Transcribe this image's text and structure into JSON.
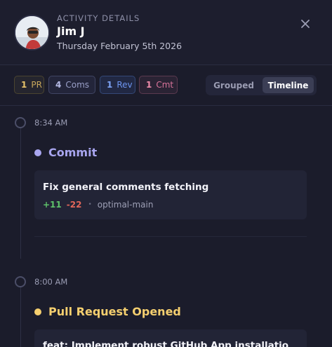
{
  "header": {
    "eyebrow": "ACTIVITY DETAILS",
    "name": "Jim J",
    "date": "Thursday February 5th 2026"
  },
  "filters": [
    {
      "count": "1",
      "label": "PR"
    },
    {
      "count": "4",
      "label": "Coms"
    },
    {
      "count": "1",
      "label": "Rev"
    },
    {
      "count": "1",
      "label": "Cmt"
    }
  ],
  "view_toggle": {
    "grouped": "Grouped",
    "timeline": "Timeline",
    "selected": "Timeline"
  },
  "events": [
    {
      "time": "8:34 AM",
      "type": "Commit",
      "title": "Fix general comments fetching",
      "additions": "+11",
      "deletions": "-22",
      "separator": "•",
      "branch": "optimal-main"
    },
    {
      "time": "8:00 AM",
      "type": "Pull Request Opened",
      "title": "feat: Implement robust GitHub App installatio"
    }
  ],
  "colors": {
    "background": "#1b1c2b",
    "pr": "#e7c36a",
    "coms": "#9aa0d6",
    "rev": "#6d95f0",
    "cmt": "#e67a9d",
    "commit": "#a9a6f0",
    "pull_request": "#f5cf6f",
    "additions": "#5ec26a",
    "deletions": "#e1665a",
    "toggle_active": "#3b3e55"
  },
  "icons": {
    "close": "close-icon",
    "avatar": "avatar"
  }
}
